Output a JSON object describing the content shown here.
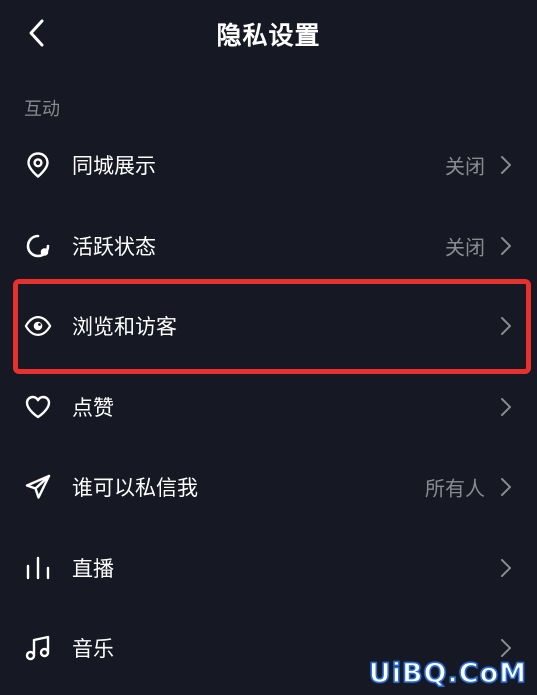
{
  "header": {
    "title": "隐私设置"
  },
  "section": {
    "label": "互动"
  },
  "items": [
    {
      "icon": "location-pin-icon",
      "label": "同城展示",
      "value": "关闭"
    },
    {
      "icon": "activity-status-icon",
      "label": "活跃状态",
      "value": "关闭"
    },
    {
      "icon": "eye-icon",
      "label": "浏览和访客",
      "value": ""
    },
    {
      "icon": "heart-icon",
      "label": "点赞",
      "value": ""
    },
    {
      "icon": "paper-plane-icon",
      "label": "谁可以私信我",
      "value": "所有人"
    },
    {
      "icon": "live-bars-icon",
      "label": "直播",
      "value": ""
    },
    {
      "icon": "music-note-icon",
      "label": "音乐",
      "value": ""
    }
  ],
  "watermark": "UiBQ.CoM",
  "colors": {
    "background": "#161823",
    "text_primary": "#ffffff",
    "text_secondary": "#8a8b91",
    "highlight": "#e8302f",
    "watermark_outline": "#2a6fd8"
  }
}
